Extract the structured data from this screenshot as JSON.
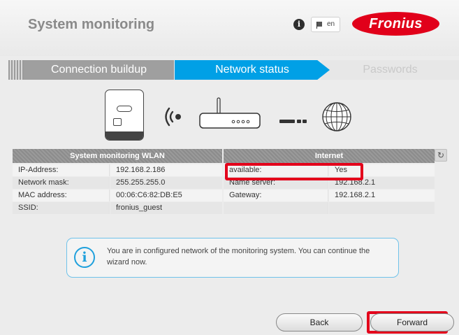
{
  "header": {
    "title": "System monitoring",
    "info_icon": "info-icon",
    "language": "en",
    "logo_text": "Fronius",
    "brand_color": "#e1001a"
  },
  "steps": [
    {
      "label": "Connection buildup",
      "state": "done"
    },
    {
      "label": "Network status",
      "state": "active"
    },
    {
      "label": "Passwords",
      "state": "upcoming"
    }
  ],
  "diagram": {
    "icons": [
      "inverter-icon",
      "wifi-signal-icon",
      "router-icon",
      "connection-dash-icon",
      "globe-icon"
    ]
  },
  "status_table": {
    "wlan_header": "System monitoring WLAN",
    "internet_header": "Internet",
    "refresh_icon": "refresh-icon",
    "wlan_rows": [
      {
        "label": "IP-Address:",
        "value": "192.168.2.186"
      },
      {
        "label": "Network mask:",
        "value": "255.255.255.0"
      },
      {
        "label": "MAC address:",
        "value": "00:06:C6:82:DB:E5"
      },
      {
        "label": "SSID:",
        "value": "fronius_guest"
      }
    ],
    "internet_rows": [
      {
        "label": "available:",
        "value": "Yes"
      },
      {
        "label": "Name server:",
        "value": "192.168.2.1"
      },
      {
        "label": "Gateway:",
        "value": "192.168.2.1"
      }
    ]
  },
  "info_message": "You are in configured network of the monitoring system. You can continue the wizard now.",
  "buttons": {
    "back": "Back",
    "forward": "Forward"
  },
  "colors": {
    "accent": "#00a0e6",
    "highlight": "#e3001b",
    "info_border": "#6fc2ea"
  }
}
